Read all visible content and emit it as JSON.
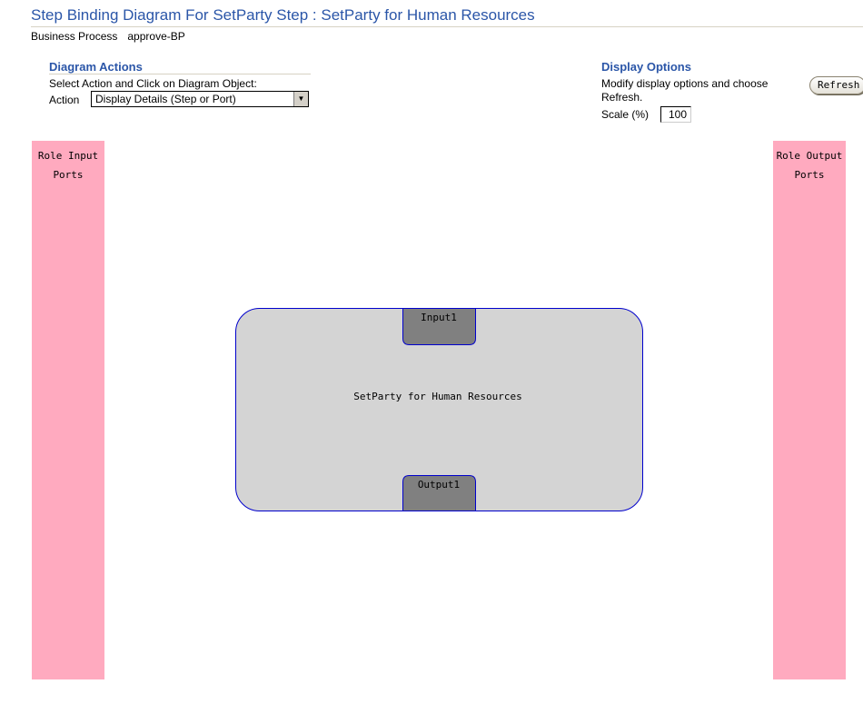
{
  "page": {
    "title": "Step Binding Diagram For SetParty Step : SetParty for Human Resources"
  },
  "business_process": {
    "label": "Business Process",
    "value": "approve-BP"
  },
  "diagram_actions": {
    "heading": "Diagram Actions",
    "instruction": "Select Action and Click on Diagram Object:",
    "action_label": "Action",
    "action_selected": "Display Details (Step or Port)"
  },
  "display_options": {
    "heading": "Display Options",
    "instruction_line1": "Modify display options and choose",
    "instruction_line2": "Refresh.",
    "refresh_label": "Refresh",
    "scale_label": "Scale (%)",
    "scale_value": "100"
  },
  "ports": {
    "input_column_line1": "Role Input",
    "input_column_line2": "Ports",
    "output_column_line1": "Role Output",
    "output_column_line2": "Ports"
  },
  "step": {
    "name": "SetParty for Human Resources",
    "input_port": "Input1",
    "output_port": "Output1"
  },
  "colors": {
    "title_blue": "#2b56a8",
    "port_column_pink": "#ffaabf",
    "step_fill": "#d4d4d4",
    "port_fill": "#808080",
    "outline_blue": "#0000cc"
  }
}
